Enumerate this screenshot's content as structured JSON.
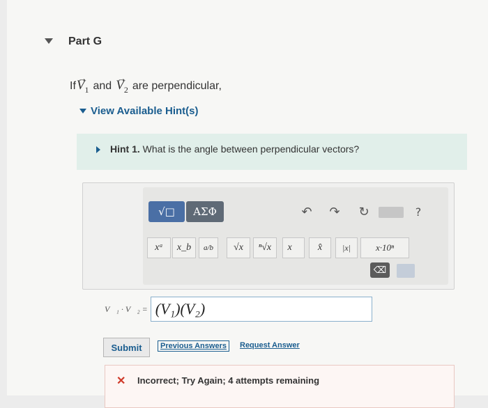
{
  "part": {
    "title": "Part G"
  },
  "question": {
    "prefix": "If",
    "vector1": "V",
    "vector1_sub": "1",
    "connector": "and",
    "vector2": "V",
    "vector2_sub": "2",
    "suffix": "are perpendicular,"
  },
  "hints": {
    "toggle_label": "View Available Hint(s)",
    "items": [
      {
        "number": "Hint 1.",
        "text": "What is the angle between perpendicular vectors?"
      }
    ]
  },
  "toolbar": {
    "template_button": "√□",
    "greek_button": "ΑΣΦ",
    "undo_icon": "undo-icon",
    "redo_icon": "redo-icon",
    "reset_icon": "reset-icon",
    "keyboard_icon": "keyboard-icon",
    "help_label": "?",
    "math_keys": [
      "xᵃ",
      "x_b",
      "a/b",
      "√x",
      "ⁿ√x",
      "x⃗",
      "x̂",
      "|x|",
      "x·10ⁿ"
    ],
    "backspace_icon": "backspace-icon",
    "keyboard_toggle_icon": "keyboard-toggle-icon"
  },
  "answer": {
    "label": "V⃗₁ · V⃗₂ =",
    "value": "(V₁)(V₂)"
  },
  "actions": {
    "submit": "Submit",
    "previous_answers": "Previous Answers",
    "request_answer": "Request Answer"
  },
  "feedback": {
    "status": "incorrect",
    "message": "Incorrect; Try Again; 4 attempts remaining",
    "color": "#cf3a2a"
  }
}
